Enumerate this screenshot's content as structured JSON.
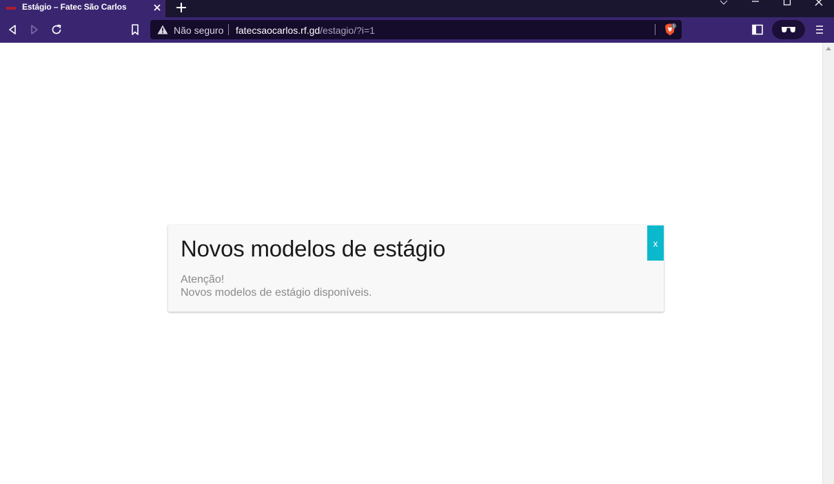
{
  "browser": {
    "tab": {
      "title": "Estágio – Fatec São Carlos",
      "favicon": "fatec-favicon-icon"
    },
    "address_bar": {
      "security_label": "Não seguro",
      "url_host": "fatecsaocarlos.rf.gd",
      "url_path": "/estagio/?i=1"
    },
    "shields_badge": "1",
    "colors": {
      "tab_strip": "#1b1630",
      "toolbar": "#3a2670",
      "omnibox": "#150b2b"
    }
  },
  "modal": {
    "title": "Novos modelos de estágio",
    "body_line1": "Atenção!",
    "body_line2": "Novos modelos de estágio disponíveis.",
    "close_label": "x",
    "close_color": "#0bb8cc"
  }
}
